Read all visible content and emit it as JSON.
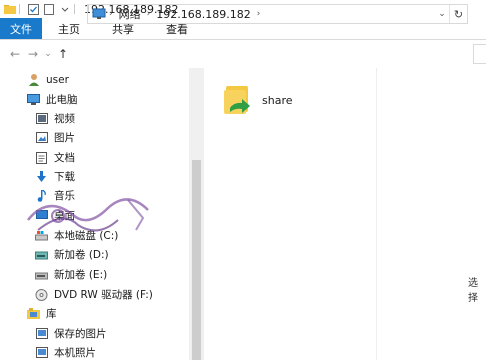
{
  "window": {
    "title": "192.168.189.182"
  },
  "ribbon": {
    "tabs": [
      "文件",
      "主页",
      "共享",
      "查看"
    ]
  },
  "address_bar": {
    "segments": [
      "网络",
      "192.168.189.182"
    ]
  },
  "sidebar": {
    "items": [
      {
        "label": "user",
        "icon": "user-icon"
      },
      {
        "label": "此电脑",
        "icon": "computer-icon"
      },
      {
        "label": "视频",
        "icon": "video-icon"
      },
      {
        "label": "图片",
        "icon": "pictures-icon"
      },
      {
        "label": "文档",
        "icon": "documents-icon"
      },
      {
        "label": "下载",
        "icon": "download-icon"
      },
      {
        "label": "音乐",
        "icon": "music-icon"
      },
      {
        "label": "桌面",
        "icon": "desktop-icon"
      },
      {
        "label": "本地磁盘 (C:)",
        "icon": "drive-c-icon"
      },
      {
        "label": "新加卷 (D:)",
        "icon": "drive-icon"
      },
      {
        "label": "新加卷 (E:)",
        "icon": "drive-icon"
      },
      {
        "label": "DVD RW 驱动器 (F:)",
        "icon": "dvd-drive-icon"
      },
      {
        "label": "库",
        "icon": "library-icon"
      },
      {
        "label": "保存的图片",
        "icon": "saved-pictures-icon"
      },
      {
        "label": "本机照片",
        "icon": "camera-roll-icon"
      }
    ]
  },
  "content": {
    "items": [
      {
        "label": "share",
        "icon": "shared-folder-icon"
      }
    ],
    "side_text": "选择"
  },
  "colors": {
    "accent": "#1979ca",
    "folder": "#f4c842",
    "share_arrow": "#2f9e44"
  }
}
